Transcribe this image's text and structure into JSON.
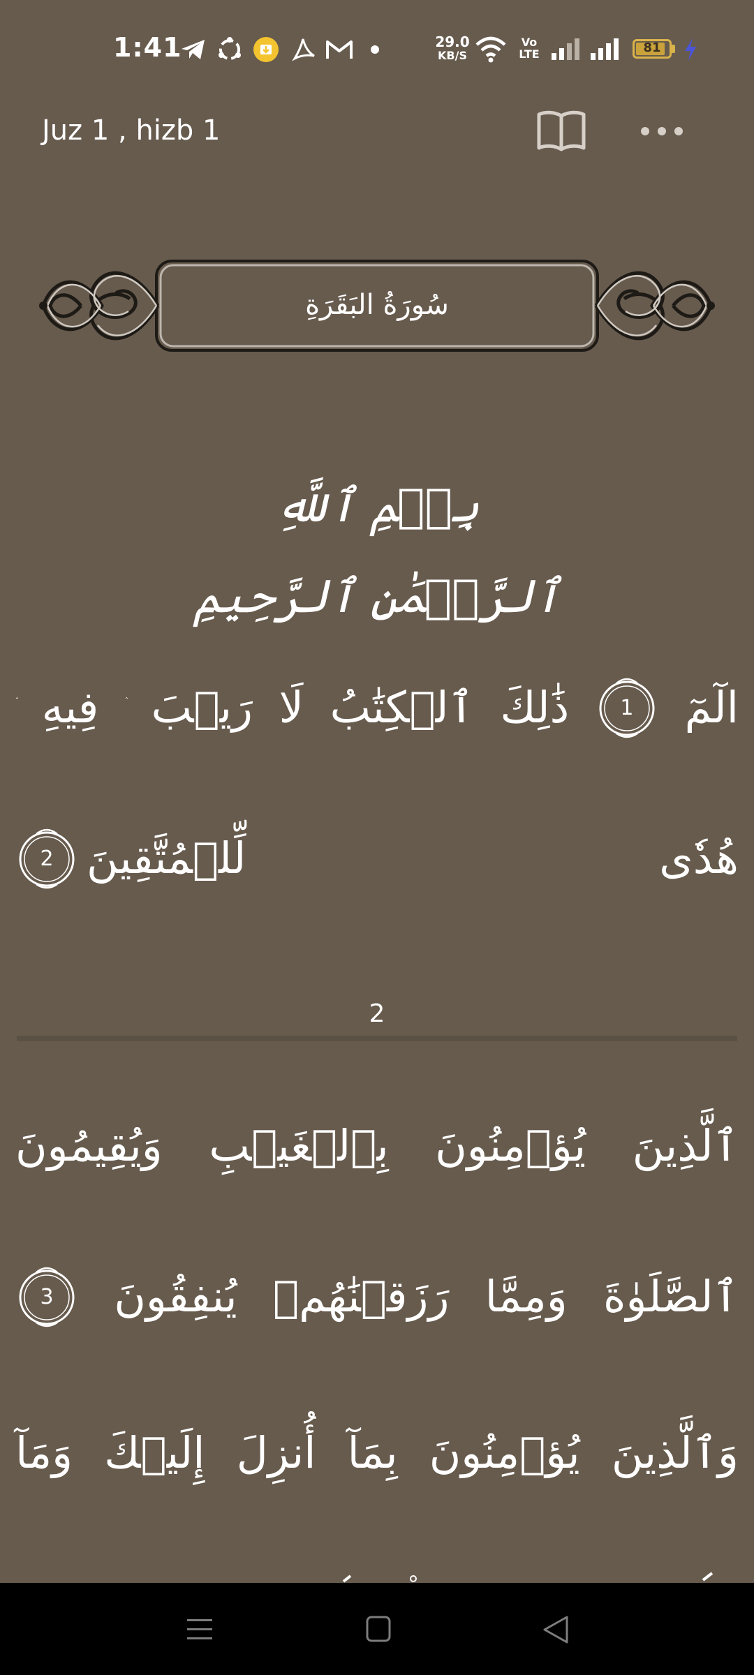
{
  "status_bar": {
    "time": "1:41",
    "net_speed_value": "29.0",
    "net_speed_unit": "KB/S",
    "volte": "Vo LTE",
    "battery_level": "81",
    "icons": [
      "telegram-icon",
      "sync-icon",
      "download-badge-icon",
      "acrobat-icon",
      "gmail-icon",
      "dot-icon",
      "wifi-icon",
      "signal-icon",
      "signal-icon",
      "charging-icon"
    ]
  },
  "header": {
    "title": "Juz 1 , hizb 1",
    "book_icon": "open-book-icon",
    "more_icon": "more-horizontal-icon"
  },
  "surah": {
    "name": "سُورَةُ البَقَرَةِ"
  },
  "basmala": "بِسۡمِ ٱللَّهِ ٱلرَّحۡمَٰنِ ٱلرَّحِيمِ",
  "page_prev": {
    "line1": {
      "words": [
        "الٓمٓ",
        "ذَٰلِكَ",
        "ٱلۡكِتَٰبُ",
        "لَا",
        "رَيۡبَ",
        "ۛ",
        "فِيهِ",
        "ۛ"
      ],
      "ayah": "1"
    },
    "line2": {
      "words": [
        "هُدٗى",
        "لِّلۡمُتَّقِينَ"
      ],
      "ayah": "2"
    }
  },
  "page_number": "2",
  "page_current": {
    "line1": {
      "words": [
        "ٱلَّذِينَ",
        "يُؤۡمِنُونَ",
        "بِٱلۡغَيۡبِ",
        "وَيُقِيمُونَ"
      ]
    },
    "line2": {
      "words": [
        "ٱلصَّلَوٰةَ",
        "وَمِمَّا",
        "رَزَقۡنَٰهُمۡ",
        "يُنفِقُونَ"
      ],
      "ayah": "3"
    },
    "line3": {
      "words": [
        "وَٱلَّذِينَ",
        "يُؤۡمِنُونَ",
        "بِمَآ",
        "أُنزِلَ",
        "إِلَيۡكَ",
        "وَمَآ"
      ]
    }
  },
  "nav_bar": {
    "icons": [
      "menu-icon",
      "home-icon",
      "back-icon"
    ]
  }
}
